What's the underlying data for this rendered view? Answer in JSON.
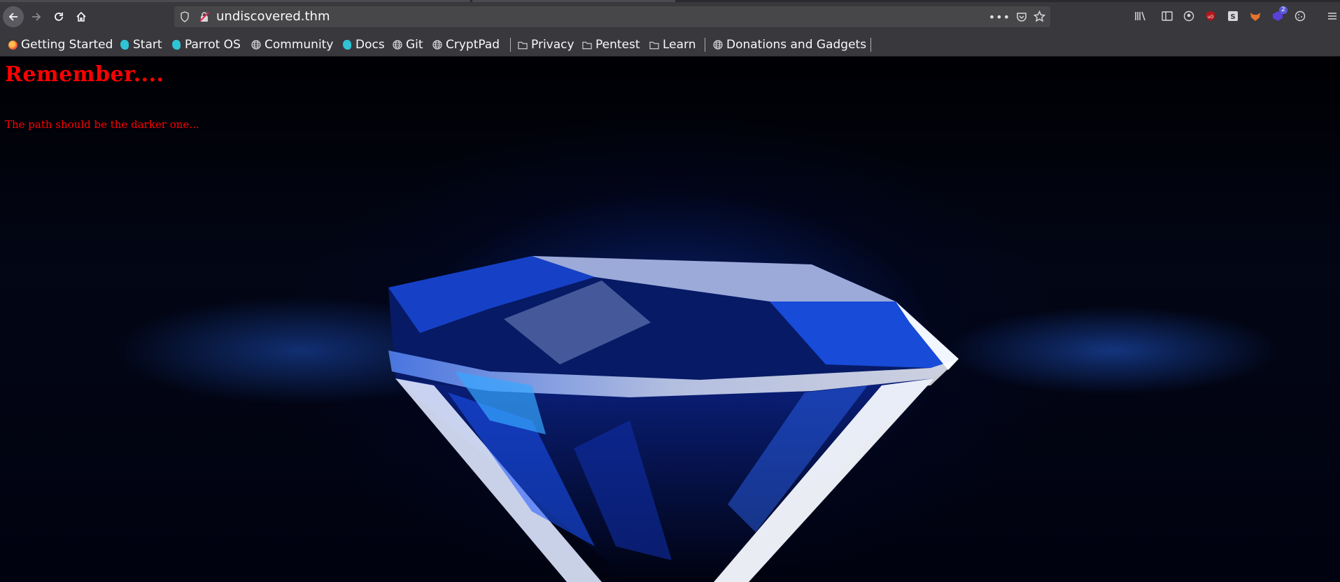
{
  "browser": {
    "url": "undiscovered.thm",
    "extension_badge_count": "2"
  },
  "bookmarks": [
    {
      "label": "Getting Started",
      "icon": "firefox-icon"
    },
    {
      "label": "Start",
      "icon": "parrot-icon"
    },
    {
      "label": "Parrot OS",
      "icon": "parrot-icon"
    },
    {
      "label": "Community",
      "icon": "globe-icon"
    },
    {
      "label": "Docs",
      "icon": "parrot-icon"
    },
    {
      "label": "Git",
      "icon": "globe-icon"
    },
    {
      "label": "CryptPad",
      "icon": "globe-icon"
    },
    {
      "label": "Privacy",
      "icon": "folder-icon"
    },
    {
      "label": "Pentest",
      "icon": "folder-icon"
    },
    {
      "label": "Learn",
      "icon": "folder-icon"
    },
    {
      "label": "Donations and Gadgets",
      "icon": "globe-icon"
    }
  ],
  "page": {
    "heading": "Remember....",
    "text": "The path should be the darker one...",
    "text_color": "#ff0000",
    "background": "blue diamond image"
  }
}
